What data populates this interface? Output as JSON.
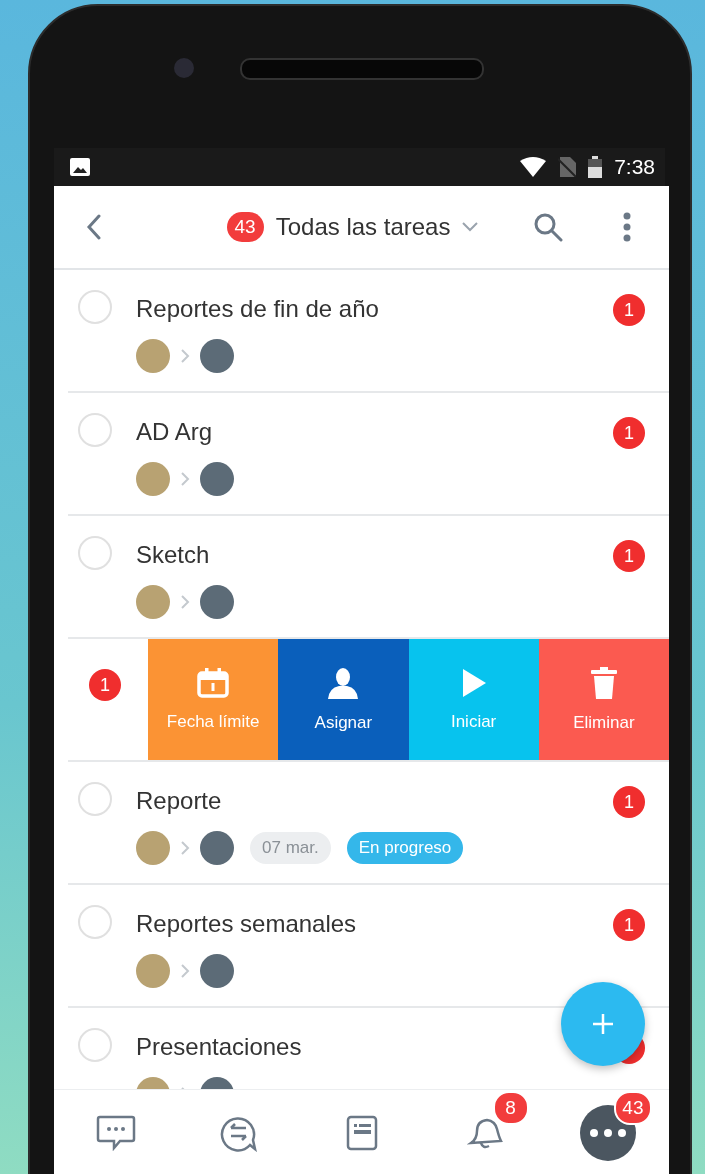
{
  "status_bar": {
    "time": "7:38"
  },
  "header": {
    "count": "43",
    "title": "Todas las tareas"
  },
  "tasks": [
    {
      "kind": "task",
      "title": "Reportes de fin de año",
      "checked": false,
      "badge": "1"
    },
    {
      "kind": "task",
      "title": "AD Arg",
      "checked": false,
      "badge": "1"
    },
    {
      "kind": "task",
      "title": "Sketch",
      "checked": false,
      "badge": "1"
    },
    {
      "kind": "swiped",
      "badge": "1",
      "actions": [
        {
          "kind": "date",
          "label": "Fecha límite"
        },
        {
          "kind": "assign",
          "label": "Asignar"
        },
        {
          "kind": "start",
          "label": "Iniciar"
        },
        {
          "kind": "delete",
          "label": "Eliminar"
        }
      ]
    },
    {
      "kind": "task",
      "title": "Reporte",
      "checked": false,
      "badge": "1",
      "date": "07 mar.",
      "status": "En progreso"
    },
    {
      "kind": "task",
      "title": "Reportes semanales",
      "checked": false,
      "badge": "1"
    },
    {
      "kind": "task",
      "title": "Presentaciones",
      "checked": false,
      "unread": true
    }
  ],
  "bottom_nav": [
    {
      "kind": "chat",
      "selected": false
    },
    {
      "kind": "discussions",
      "selected": false
    },
    {
      "kind": "notes",
      "selected": false
    },
    {
      "kind": "notifications",
      "selected": false,
      "badge": "8"
    },
    {
      "kind": "more",
      "selected": true,
      "badge": "43"
    }
  ]
}
